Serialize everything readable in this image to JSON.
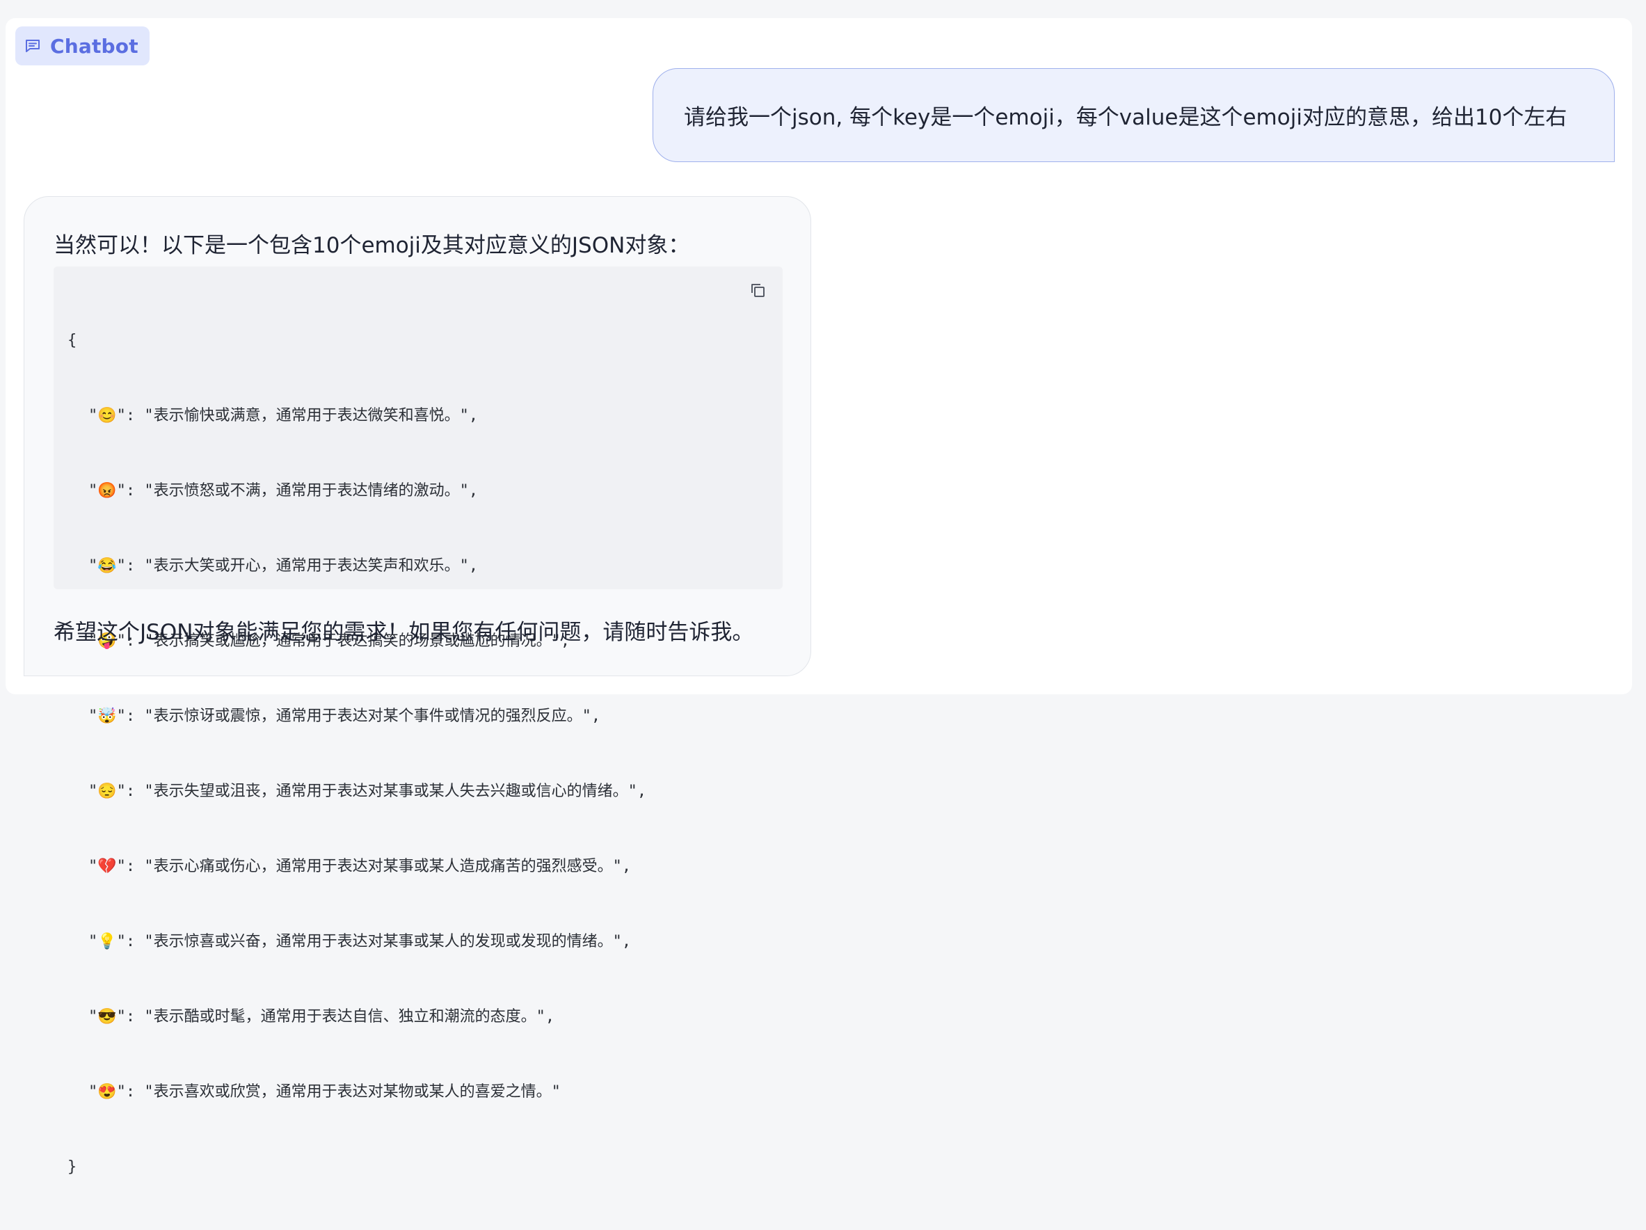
{
  "header": {
    "label": "Chatbot",
    "icon": "chat-bubble-icon",
    "accent_color": "#5b6ee1",
    "label_bg": "#e1e7fd"
  },
  "conversation": {
    "user_message": "请给我一个json, 每个key是一个emoji，每个value是这个emoji对应的意思，给出10个左右",
    "bot": {
      "intro": "当然可以！以下是一个包含10个emoji及其对应意义的JSON对象：",
      "code": {
        "open": "{",
        "close": "}",
        "copy_icon": "copy-icon",
        "lines": [
          "\"😊\": \"表示愉快或满意，通常用于表达微笑和喜悦。\",",
          "\"😡\": \"表示愤怒或不满，通常用于表达情绪的激动。\",",
          "\"😂\": \"表示大笑或开心，通常用于表达笑声和欢乐。\",",
          "\"🤪\": \"表示搞笑或尴尬，通常用于表达搞笑的场景或尴尬的情况。\",",
          "\"🤯\": \"表示惊讶或震惊，通常用于表达对某个事件或情况的强烈反应。\",",
          "\"😔\": \"表示失望或沮丧，通常用于表达对某事或某人失去兴趣或信心的情绪。\",",
          "\"💔\": \"表示心痛或伤心，通常用于表达对某事或某人造成痛苦的强烈感受。\",",
          "\"💡\": \"表示惊喜或兴奋，通常用于表达对某事或某人的发现或发现的情绪。\",",
          "\"😎\": \"表示酷或时髦，通常用于表达自信、独立和潮流的态度。\",",
          "\"😍\": \"表示喜欢或欣赏，通常用于表达对某物或某人的喜爱之情。\""
        ]
      },
      "outro": "希望这个JSON对象能满足您的需求！如果您有任何问题，请随时告诉我。"
    }
  }
}
